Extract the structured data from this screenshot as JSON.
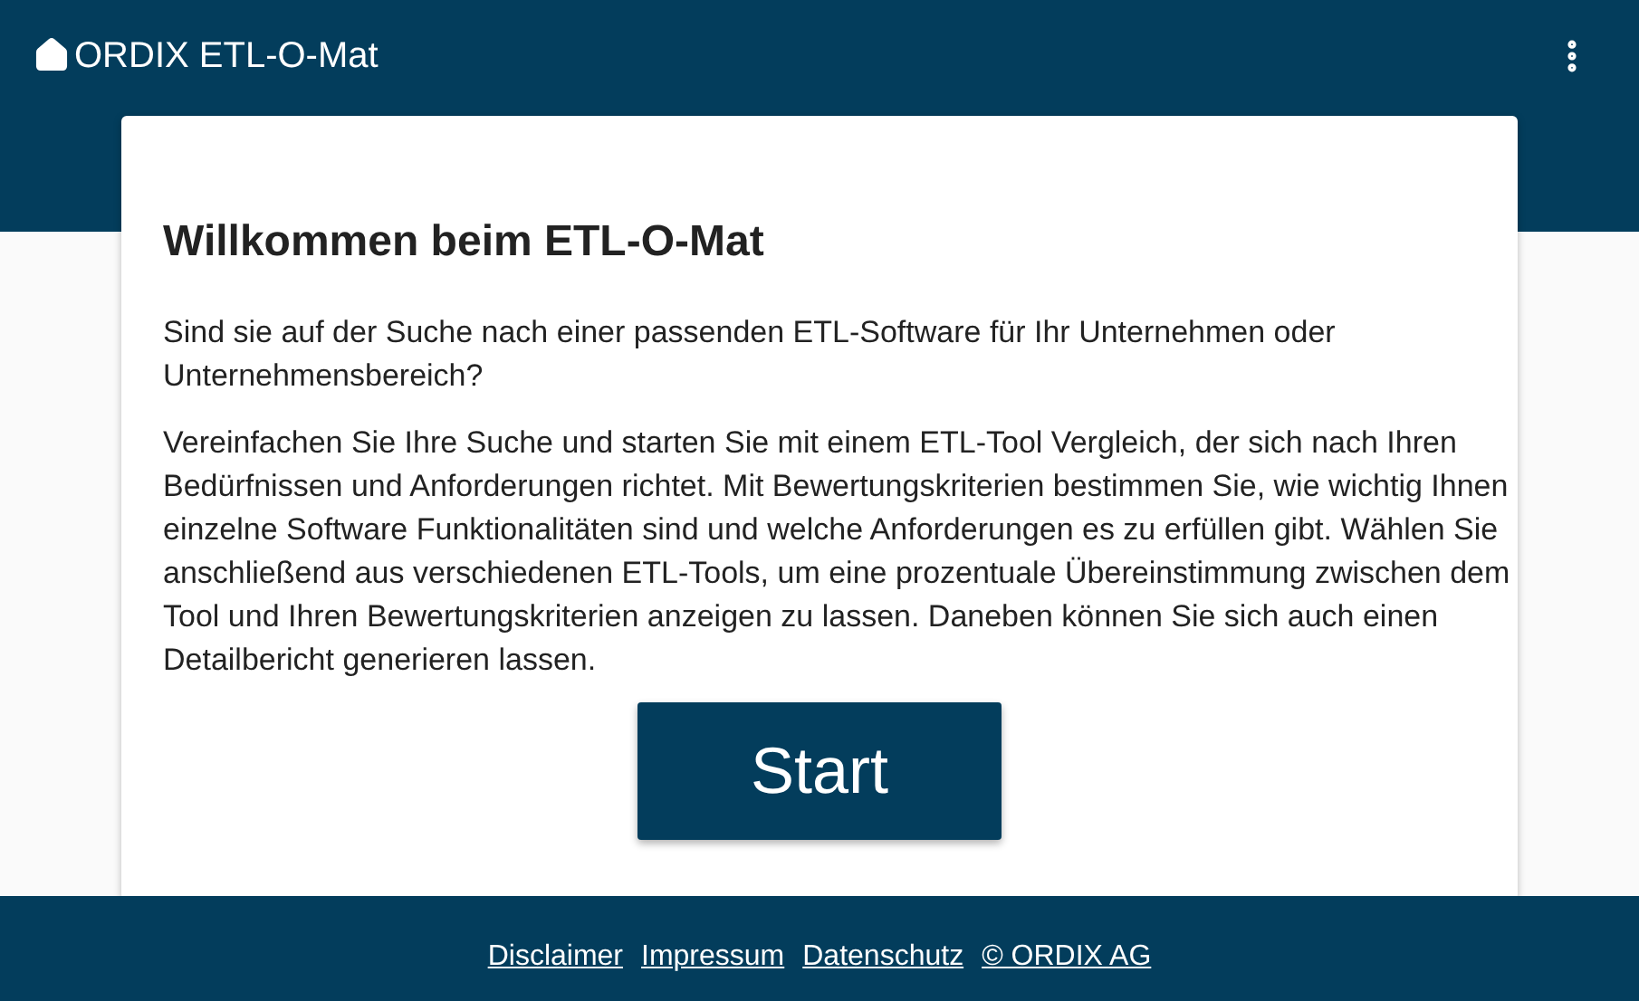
{
  "app_bar": {
    "title": "ORDIX ETL-O-Mat"
  },
  "card": {
    "heading": "Willkommen beim ETL-O-Mat",
    "paragraphs": [
      "Sind sie auf der Suche nach einer passenden ETL-Software für Ihr Unternehmen oder Unternehmensbereich?",
      "Vereinfachen Sie Ihre Suche und starten Sie mit einem ETL-Tool Vergleich, der sich nach Ihren Bedürfnissen und Anforderungen richtet. Mit Bewertungskriterien bestimmen Sie, wie wichtig Ihnen einzelne Software Funktionalitäten sind und welche Anforderungen es zu erfüllen gibt. Wählen Sie anschließend aus verschiedenen ETL-Tools, um eine prozentuale Übereinstimmung zwischen dem Tool und Ihren Bewertungskriterien anzeigen zu lassen. Daneben können Sie sich auch einen Detailbericht generieren lassen."
    ],
    "button": "Start"
  },
  "footer": {
    "links": [
      "Disclaimer",
      "Impressum",
      "Datenschutz",
      "© ORDIX AG"
    ]
  }
}
